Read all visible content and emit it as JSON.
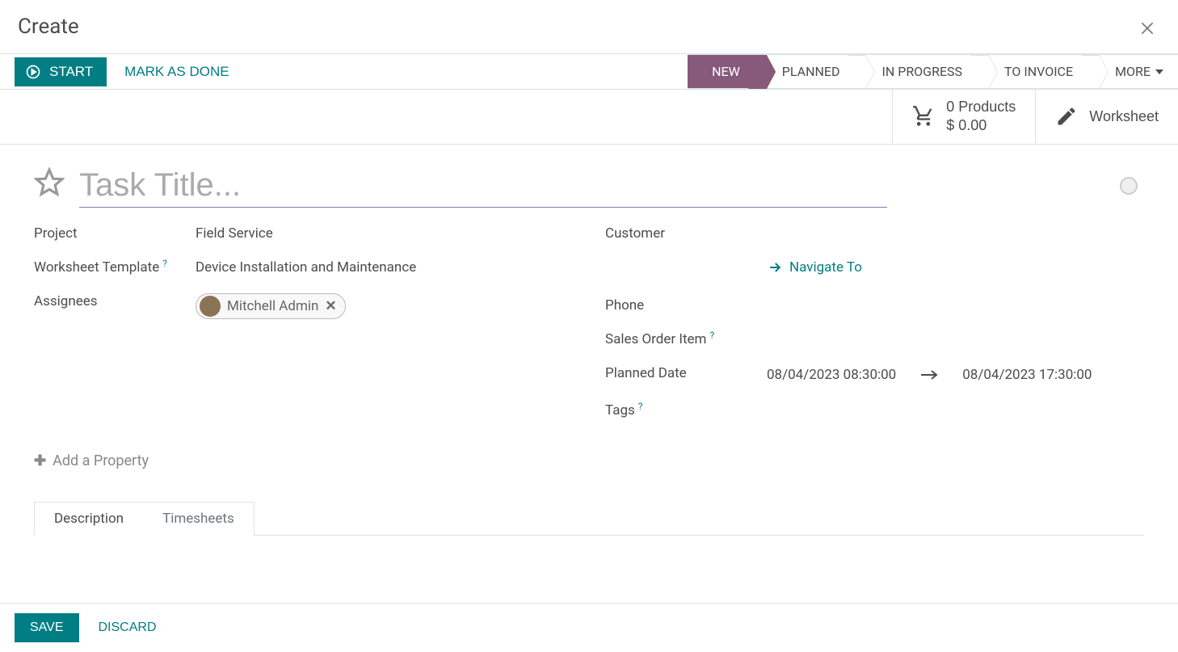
{
  "header": {
    "title": "Create"
  },
  "actions": {
    "start": "START",
    "mark_done": "MARK AS DONE"
  },
  "stages": {
    "new": "NEW",
    "planned": "PLANNED",
    "in_progress": "IN PROGRESS",
    "to_invoice": "TO INVOICE",
    "more": "MORE"
  },
  "stat_buttons": {
    "products_line1": "0 Products",
    "products_line2": "$ 0.00",
    "worksheet": "Worksheet"
  },
  "title_field": {
    "placeholder": "Task Title..."
  },
  "left": {
    "project_label": "Project",
    "project_value": "Field Service",
    "worksheet_tpl_label": "Worksheet Template",
    "worksheet_tpl_value": "Device Installation and Maintenance",
    "assignees_label": "Assignees",
    "assignee_chip": "Mitchell Admin"
  },
  "right": {
    "customer_label": "Customer",
    "navigate_label": "Navigate To",
    "phone_label": "Phone",
    "soi_label": "Sales Order Item",
    "planned_label": "Planned Date",
    "planned_start": "08/04/2023 08:30:00",
    "planned_end": "08/04/2023 17:30:00",
    "tags_label": "Tags"
  },
  "add_property": "Add a Property",
  "tabs": {
    "description": "Description",
    "timesheets": "Timesheets"
  },
  "footer": {
    "save": "SAVE",
    "discard": "DISCARD"
  }
}
